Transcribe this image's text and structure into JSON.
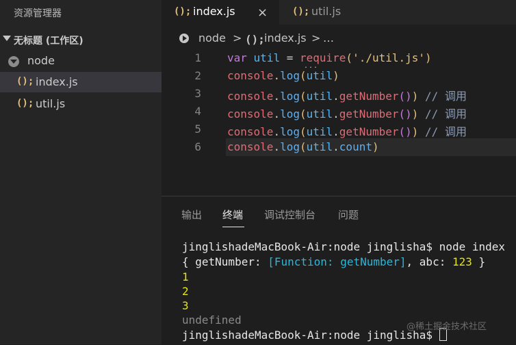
{
  "sidebar": {
    "title": "资源管理器",
    "workspace": "无标题 (工作区)",
    "folder": "node",
    "files": [
      {
        "icon": "();",
        "name": "index.js"
      },
      {
        "icon": "();",
        "name": "util.js"
      }
    ]
  },
  "tabs": [
    {
      "icon": "();",
      "name": "index.js",
      "close": "×"
    },
    {
      "icon": "();",
      "name": "util.js"
    }
  ],
  "breadcrumb": {
    "folder": "node",
    "sep": ">",
    "icon": "();",
    "file": "index.js",
    "ellipsis": "…"
  },
  "editor": {
    "line_numbers": [
      "1",
      "2",
      "3",
      "4",
      "5",
      "6"
    ],
    "squiggle": "...",
    "tokens": {
      "var": "var",
      "util": "util",
      "eq": " = ",
      "require": "require",
      "lparen": "(",
      "path": "'./util.js'",
      "rparen": ")",
      "console": "console",
      "dot": ".",
      "log": "log",
      "getNumber": "getNumber",
      "call": "()",
      "count": "count",
      "comment": " // 调用"
    }
  },
  "panel": {
    "tabs": [
      "输出",
      "终端",
      "调试控制台",
      "问题"
    ],
    "active_tab": "终端"
  },
  "terminal": {
    "prompt_cmd": "jinglishadeMacBook-Air:node jinglisha$ node index",
    "obj_open": "{ getNumber: ",
    "obj_fn": "[Function: getNumber]",
    "obj_mid": ", abc: ",
    "obj_num": "123",
    "obj_close": " }",
    "out1": "1",
    "out2": "2",
    "out3": "3",
    "undef": "undefined",
    "prompt": "jinglishadeMacBook-Air:node jinglisha$ "
  },
  "watermark": "@稀土掘金技术社区"
}
